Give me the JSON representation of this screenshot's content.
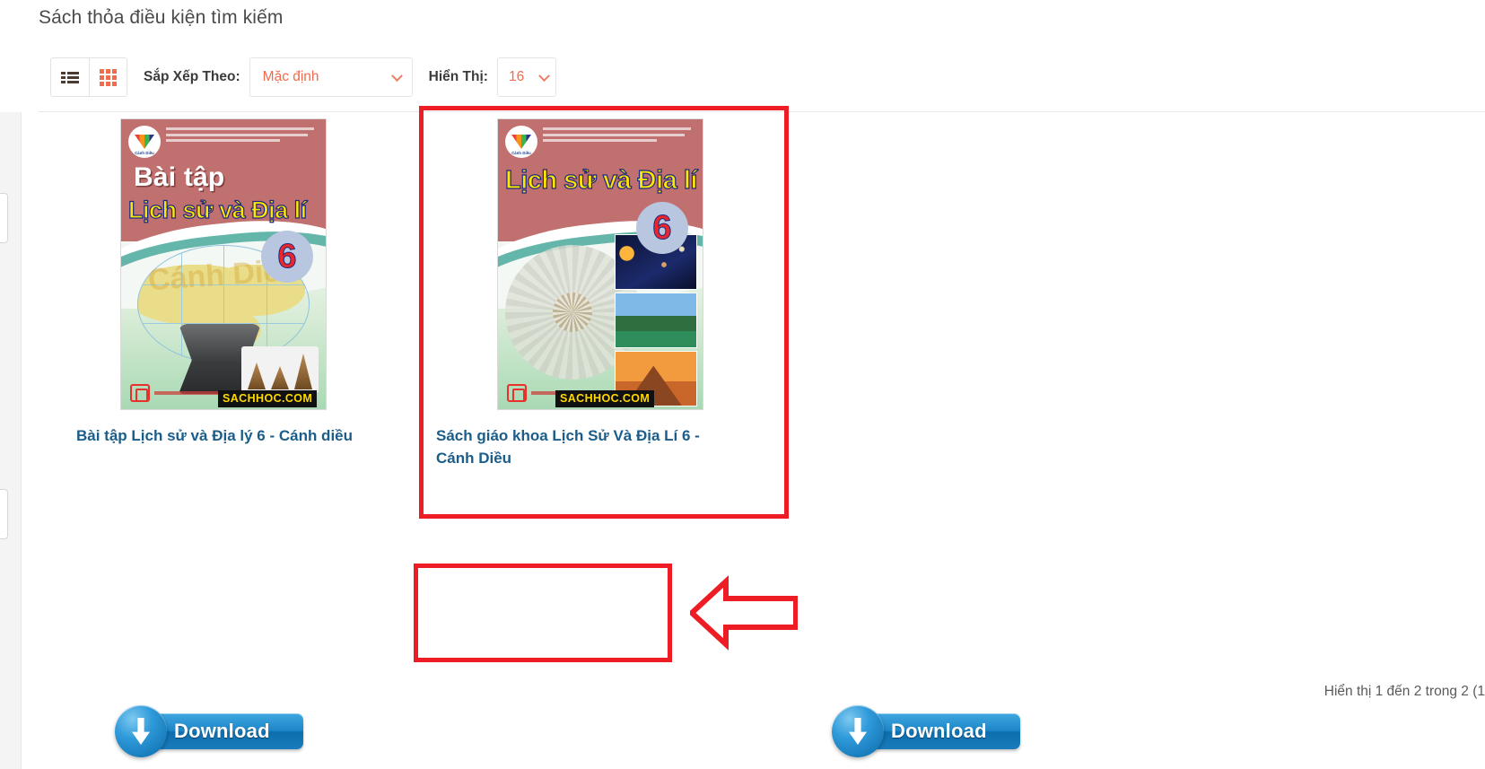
{
  "page": {
    "heading": "Sách thỏa điều kiện tìm kiếm"
  },
  "toolbar": {
    "view_list_icon": "list-view-icon",
    "view_grid_icon": "grid-view-icon",
    "sort_label": "Sắp Xếp Theo:",
    "sort_value": "Mặc định",
    "show_label": "Hiển Thị:",
    "show_value": "16",
    "accent_color": "#ef6c4d"
  },
  "products": [
    {
      "title": "Bài tập Lịch sử và Địa lý 6 - Cánh diều",
      "cover": {
        "badge_label": "Cánh Diều",
        "title_sub": "Bài tập",
        "title_main": "Lịch sử và Địa lí",
        "grade": "6",
        "ghost_text": "Cánh Diều",
        "watermark": "SACHHOC.COM"
      },
      "download_label": "Download"
    },
    {
      "title": "Sách giáo khoa Lịch Sử Và Địa Lí 6 - Cánh Diều",
      "cover": {
        "badge_label": "Cánh Diều",
        "title_sub": "",
        "title_main": "Lịch sử và Địa lí",
        "grade": "6",
        "ghost_text": "",
        "watermark": "SACHHOC.COM"
      },
      "download_label": "Download"
    }
  ],
  "annotations": {
    "highlight_color": "#ee1c25",
    "product_box_target": "product-2",
    "download_box_target": "download-button-2",
    "arrow_direction": "left"
  },
  "footer": {
    "status": "Hiển thị 1 đến 2 trong 2 (1"
  }
}
